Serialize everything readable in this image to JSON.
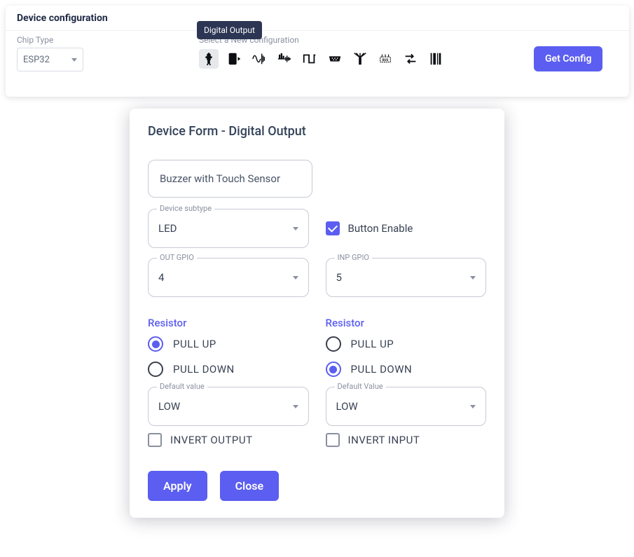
{
  "header": {
    "title": "Device configuration"
  },
  "chip": {
    "label": "Chip Type",
    "value": "ESP32"
  },
  "config_bar": {
    "label": "Select a New configuration",
    "tooltip": "Digital Output",
    "get_config": "Get Config"
  },
  "modal": {
    "title": "Device Form - Digital Output",
    "name": "Buzzer with Touch Sensor",
    "subtype_label": "Device subtype",
    "subtype_value": "LED",
    "button_enable_label": "Button Enable",
    "button_enable_checked": true,
    "out_gpio_label": "OUT GPIO",
    "out_gpio_value": "4",
    "inp_gpio_label": "INP GPIO",
    "inp_gpio_value": "5",
    "resistor_left_label": "Resistor",
    "resistor_right_label": "Resistor",
    "pull_up": "PULL UP",
    "pull_down": "PULL DOWN",
    "left_resistor": "PULL UP",
    "right_resistor": "PULL DOWN",
    "default_left_label": "Default value",
    "default_left_value": "LOW",
    "default_right_label": "Default Value",
    "default_right_value": "LOW",
    "invert_output": "INVERT OUTPUT",
    "invert_input": "INVERT INPUT",
    "apply": "Apply",
    "close": "Close"
  }
}
